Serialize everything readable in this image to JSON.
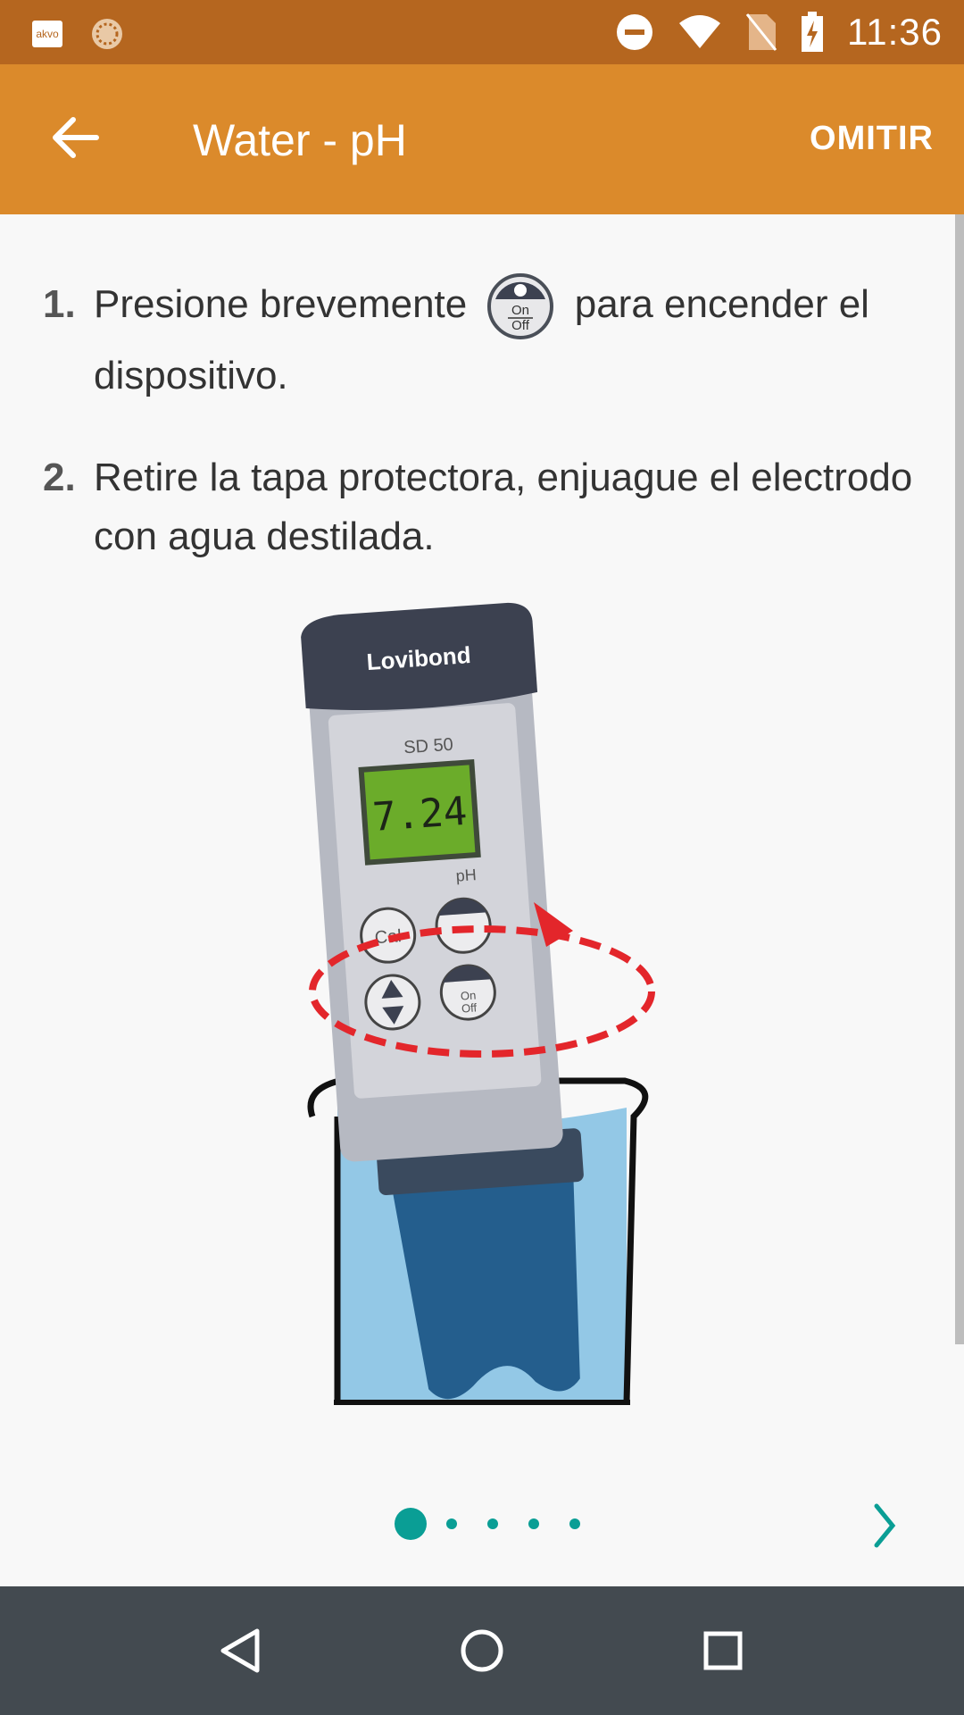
{
  "status_bar": {
    "app_icon_text": "akvo",
    "time": "11:36"
  },
  "app_bar": {
    "title": "Water - pH",
    "skip_label": "OMITIR"
  },
  "steps": [
    {
      "number": "1.",
      "text_before": "Presione brevemente",
      "icon": "on-off-button-icon",
      "text_after": "para encender el dispositivo."
    },
    {
      "number": "2.",
      "text": "Retire la tapa protectora, enjuague el electrodo con agua destilada."
    }
  ],
  "illustration": {
    "brand": "Lovibond",
    "model": "SD 50",
    "reading": "7.24",
    "unit": "pH",
    "buttons": [
      "Cal",
      "On",
      "Off"
    ]
  },
  "pager": {
    "page_count": 5,
    "current_page": 1
  },
  "colors": {
    "status_bar": "#b5661f",
    "app_bar": "#db8a2b",
    "accent": "#0a9e95",
    "nav_bar": "#434a50"
  }
}
